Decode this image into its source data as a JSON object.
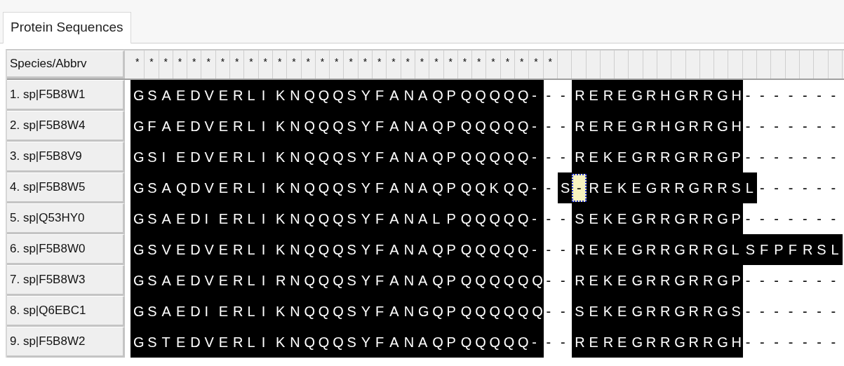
{
  "tab": {
    "label": "Protein Sequences",
    "selected": true
  },
  "grid": {
    "label_header": "Species/Abbrv",
    "conservation": [
      "*",
      "*",
      "*",
      "*",
      "*",
      "*",
      "*",
      "*",
      "*",
      "*",
      "*",
      "*",
      "*",
      "*",
      "*",
      "*",
      "*",
      "*",
      "*",
      "*",
      "*",
      "*",
      "*",
      "*",
      "*",
      "*",
      "*",
      "*",
      "*",
      "*"
    ],
    "rows": [
      {
        "label": "1. sp|F5B8W1",
        "segments": [
          {
            "text": "G S A E D V E R L I K N Q Q Q S Y F A N A Q P Q Q Q Q Q -",
            "shaded": true
          },
          {
            "text": "- -",
            "shaded": false
          },
          {
            "text": "R E R E G R H G R R G H",
            "shaded": true
          },
          {
            "text": "- - - - - - -",
            "shaded": false
          }
        ]
      },
      {
        "label": "2. sp|F5B8W4",
        "segments": [
          {
            "text": "G F A E D V E R L I K N Q Q Q S Y F A N A Q P Q Q Q Q Q -",
            "shaded": true
          },
          {
            "text": "- -",
            "shaded": false
          },
          {
            "text": "R E R E G R H G R R G H",
            "shaded": true
          },
          {
            "text": "- - - - - - -",
            "shaded": false
          }
        ]
      },
      {
        "label": "3. sp|F5B8V9",
        "segments": [
          {
            "text": "G S I E D V E R L I K N Q Q Q S Y F A N A Q P Q Q Q Q Q -",
            "shaded": true
          },
          {
            "text": "- -",
            "shaded": false
          },
          {
            "text": "R E K E G R R G R R G P",
            "shaded": true
          },
          {
            "text": "- - - - - - -",
            "shaded": false
          }
        ]
      },
      {
        "label": "4. sp|F5B8W5",
        "segments": [
          {
            "text": "G S A Q D V E R L I K N Q Q Q S Y F A N A Q P Q Q K Q Q -",
            "shaded": true
          },
          {
            "text": "-",
            "shaded": false
          },
          {
            "text": "S",
            "shaded": true
          },
          {
            "text": "-",
            "shaded": true,
            "cursor": true
          },
          {
            "text": "R E K E G R R G R R S L",
            "shaded": true
          },
          {
            "text": "- - - - - -",
            "shaded": false
          }
        ]
      },
      {
        "label": "5. sp|Q53HY0",
        "segments": [
          {
            "text": "G S A E D I E R L I K N Q Q Q S Y F A N A L P Q Q Q Q Q -",
            "shaded": true
          },
          {
            "text": "- -",
            "shaded": false
          },
          {
            "text": "S E K E G R R G R R G P",
            "shaded": true
          },
          {
            "text": "- - - - - - -",
            "shaded": false
          }
        ]
      },
      {
        "label": "6. sp|F5B8W0",
        "segments": [
          {
            "text": "G S V E D V E R L I K N Q Q Q S Y F A N A Q P Q Q Q Q Q -",
            "shaded": true
          },
          {
            "text": "- -",
            "shaded": false
          },
          {
            "text": "R E K E G R R G R R G L S F P F R S L",
            "shaded": true
          }
        ]
      },
      {
        "label": "7. sp|F5B8W3",
        "segments": [
          {
            "text": "G S A E D V E R L I R N Q Q Q S Y F A N A Q P Q Q Q Q Q Q",
            "shaded": true
          },
          {
            "text": "- -",
            "shaded": false
          },
          {
            "text": "R E K E G R R G R R G P",
            "shaded": true
          },
          {
            "text": "- - - - - - -",
            "shaded": false
          }
        ]
      },
      {
        "label": "8. sp|Q6EBC1",
        "segments": [
          {
            "text": "G S A E D I E R L I K N Q Q Q S Y F A N G Q P Q Q Q Q Q Q",
            "shaded": true
          },
          {
            "text": "- -",
            "shaded": false
          },
          {
            "text": "S E K E G R R G R R G S",
            "shaded": true
          },
          {
            "text": "- - - - - - -",
            "shaded": false
          }
        ]
      },
      {
        "label": "9. sp|F5B8W2",
        "segments": [
          {
            "text": "G S T E D V E R L I K N Q Q Q S Y F A N A Q P Q Q Q Q Q -",
            "shaded": true
          },
          {
            "text": "- -",
            "shaded": false
          },
          {
            "text": "R E R E G R R G R R G H",
            "shaded": true
          },
          {
            "text": "- - - - - - -",
            "shaded": false
          }
        ]
      }
    ]
  }
}
